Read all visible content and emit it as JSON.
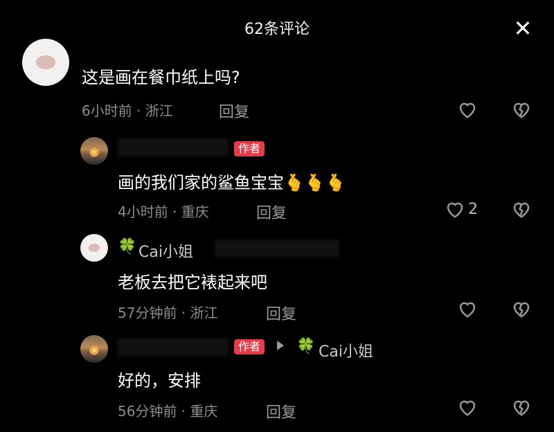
{
  "header": {
    "title": "62条评论",
    "close_icon": "close-icon"
  },
  "comments": [
    {
      "text": "这是画在餐巾纸上吗?",
      "time": "6小时前",
      "location": "浙江",
      "reply_label": "回复",
      "likes": ""
    },
    {
      "author_badge": "作者",
      "text": "画的我们家的鲨鱼宝宝",
      "emoji": "🫰🫰🫰",
      "time": "4小时前",
      "location": "重庆",
      "reply_label": "回复",
      "likes": "2"
    },
    {
      "clover": "🍀",
      "name": "Cai小姐",
      "text": "老板去把它裱起来吧",
      "time": "57分钟前",
      "location": "浙江",
      "reply_label": "回复",
      "likes": ""
    },
    {
      "author_badge": "作者",
      "reply_to_clover": "🍀",
      "reply_to_name": "Cai小姐",
      "text": "好的，安排",
      "time": "56分钟前",
      "location": "重庆",
      "reply_label": "回复",
      "likes": ""
    }
  ],
  "colors": {
    "background": "#000000",
    "author_badge": "#e63b49",
    "meta": "#8e8e8e"
  }
}
